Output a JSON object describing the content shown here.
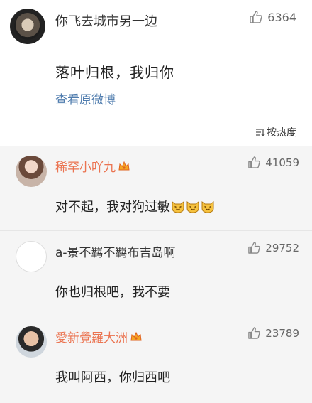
{
  "post": {
    "author": "你飞去城市另一边",
    "likes": "6364",
    "text": "落叶归根，我归你",
    "view_original": "查看原微博",
    "sort_label": "按热度"
  },
  "comments": [
    {
      "author": "稀罕小吖九",
      "likes": "41059",
      "text": "对不起，我对狗过敏",
      "emoji": "cat-face-emoji",
      "emoji_count": 3,
      "vip": true
    },
    {
      "author": "a-景不羁不羁布吉岛啊",
      "likes": "29752",
      "text": "你也归根吧，我不要",
      "vip": false
    },
    {
      "author": "愛新覺羅大洲",
      "likes": "23789",
      "text": "我叫阿西，你归西吧",
      "vip": true
    }
  ],
  "colors": {
    "username": "#eb7350",
    "link": "#4f7cae",
    "comment_bg": "#f5f5f5"
  },
  "icons": [
    "thumbs-up-icon",
    "sort-icon",
    "vip-crown-icon",
    "cat-face-emoji"
  ]
}
